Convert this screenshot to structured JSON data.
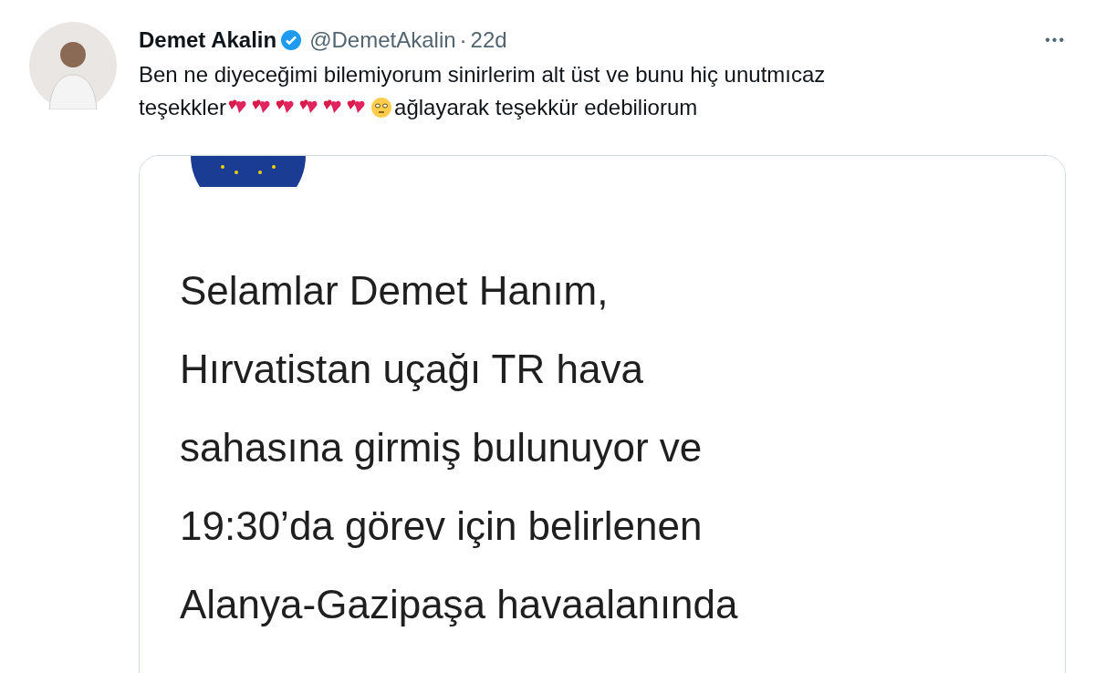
{
  "tweet": {
    "name": "Demet Akalin",
    "verified": true,
    "handle": "@DemetAkalin",
    "separator": "·",
    "time": "22d",
    "more": "•••",
    "text_line_1": "Ben ne diyeceğimi bilemiyorum sinirlerim alt üst ve bunu hiç unutmıcaz",
    "text_line_2_start": "teşekkler",
    "text_line_2_end": "ağlayarak teşekkür edebiliorum"
  },
  "media": {
    "kind": "screenshot",
    "lines": [
      "Selamlar Demet Hanım,",
      "Hırvatistan uçağı TR hava",
      "sahasına girmiş bulunuyor ve",
      "19:30’da görev için belirlenen",
      "Alanya-Gazipaşa havaalanında"
    ]
  }
}
